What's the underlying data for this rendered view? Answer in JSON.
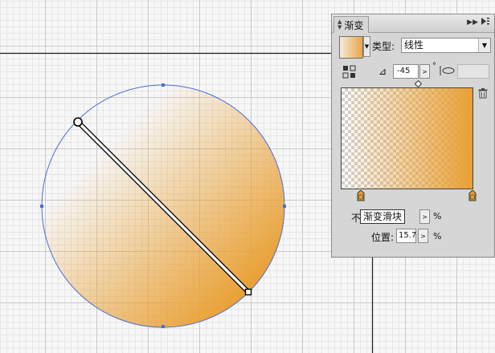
{
  "panel": {
    "title": "渐变",
    "type_label": "类型:",
    "type_value": "线性",
    "angle_value": "-45",
    "angle_unit": "°",
    "opacity_label_partial": "不",
    "tooltip": "渐变滑块",
    "opacity_unit": "%",
    "location_label": "位置:",
    "location_value": "15.7",
    "location_unit": "%"
  },
  "colors": {
    "gradient_orange": "#e9a034",
    "selection_blue": "#4a6fd8"
  },
  "icons": {
    "reverse": "reverse-gradient-icon",
    "angle": "angle-icon",
    "aspect": "aspect-ratio-icon",
    "delete": "trash-icon",
    "panel_menu": "panel-menu-icon"
  }
}
